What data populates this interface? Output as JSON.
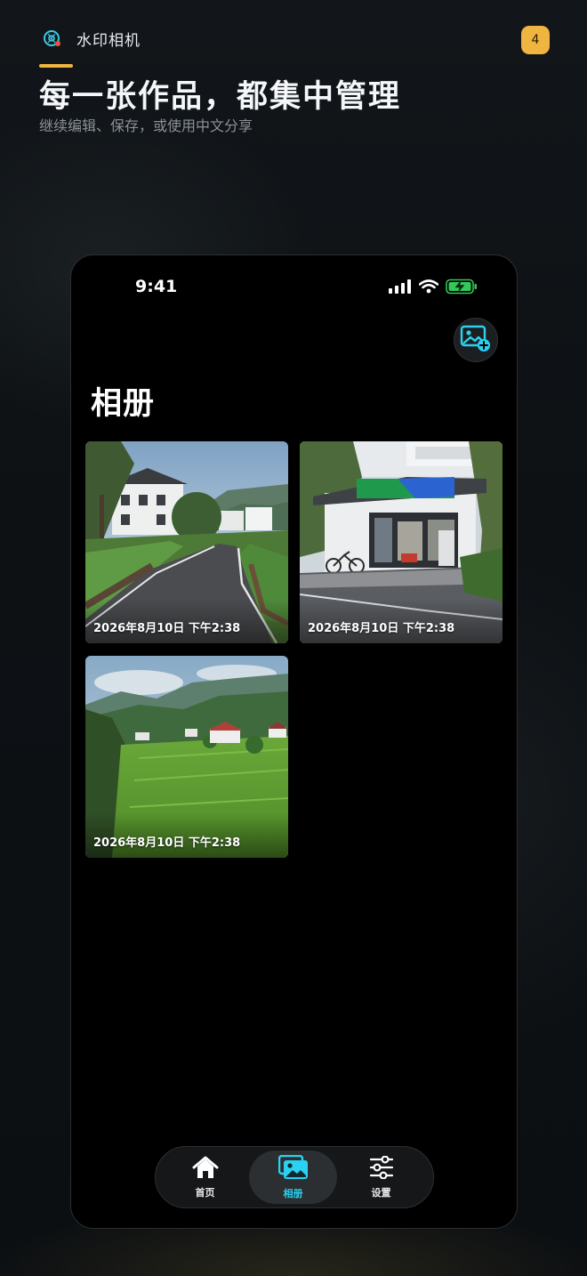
{
  "app": {
    "name": "水印相机",
    "badge_count": "4"
  },
  "hero": {
    "title": "每一张作品，都集中管理",
    "subtitle": "继续编辑、保存，或使用中文分享"
  },
  "status_bar": {
    "time": "9:41"
  },
  "album": {
    "title": "相册",
    "photos": [
      {
        "date": "2026年8月10日 下午2:38",
        "scene": "village-road"
      },
      {
        "date": "2026年8月10日 下午2:38",
        "scene": "convenience-store"
      },
      {
        "date": "2026年8月10日 下午2:38",
        "scene": "rice-terraces"
      }
    ]
  },
  "tabbar": {
    "items": [
      {
        "label": "首页",
        "icon": "home-icon"
      },
      {
        "label": "相册",
        "icon": "gallery-icon",
        "active": true
      },
      {
        "label": "设置",
        "icon": "sliders-icon"
      }
    ]
  },
  "colors": {
    "accent": "#f0b440",
    "active_tab": "#2ad1f0",
    "battery": "#34c759"
  }
}
